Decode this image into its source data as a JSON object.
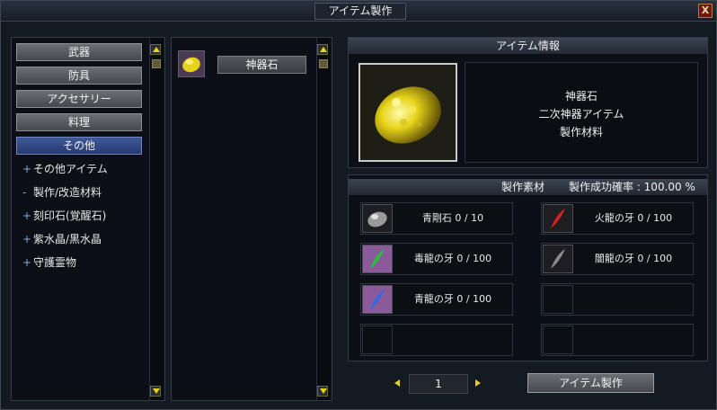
{
  "window": {
    "title": "アイテム製作",
    "close_label": "X"
  },
  "categories": [
    {
      "label": "武器",
      "active": false
    },
    {
      "label": "防具",
      "active": false
    },
    {
      "label": "アクセサリー",
      "active": false
    },
    {
      "label": "料理",
      "active": false
    },
    {
      "label": "その他",
      "active": true
    }
  ],
  "subcategories": [
    {
      "marker": "+",
      "label": "その他アイテム"
    },
    {
      "marker": "-",
      "label": "製作/改造材料"
    },
    {
      "marker": "+",
      "label": "刻印石(覚醒石)"
    },
    {
      "marker": "+",
      "label": "紫水晶/黒水晶"
    },
    {
      "marker": "+",
      "label": "守護霊物"
    }
  ],
  "recipes": [
    {
      "name": "神器石",
      "icon": "yellow-ore-icon"
    }
  ],
  "item_info": {
    "header": "アイテム情報",
    "name": "神器石",
    "type": "二次神器アイテム",
    "category": "製作材料",
    "icon": "yellow-ore-icon"
  },
  "materials": {
    "header_label": "製作素材",
    "success_rate_label": "製作成功確率 : 100.00 %",
    "slots": [
      {
        "text": "青剛石 0 / 10",
        "icon": "gray-ore-icon",
        "color": "#9a9a9a"
      },
      {
        "text": "火龍の牙 0 / 100",
        "icon": "red-fang-icon",
        "color": "#d22020"
      },
      {
        "text": "毒龍の牙 0 / 100",
        "icon": "green-fang-icon",
        "color": "#22c23a"
      },
      {
        "text": "闇龍の牙 0 / 100",
        "icon": "dark-fang-icon",
        "color": "#8a8a8a"
      },
      {
        "text": "青龍の牙 0 / 100",
        "icon": "blue-fang-icon",
        "color": "#2a6ee0"
      },
      {
        "text": "",
        "icon": ""
      },
      {
        "text": "",
        "icon": ""
      },
      {
        "text": "",
        "icon": ""
      }
    ]
  },
  "footer": {
    "quantity": "1",
    "make_button": "アイテム製作"
  },
  "colors": {
    "accent_yellow": "#e6d21a",
    "active_category": "#3f5a9a"
  }
}
